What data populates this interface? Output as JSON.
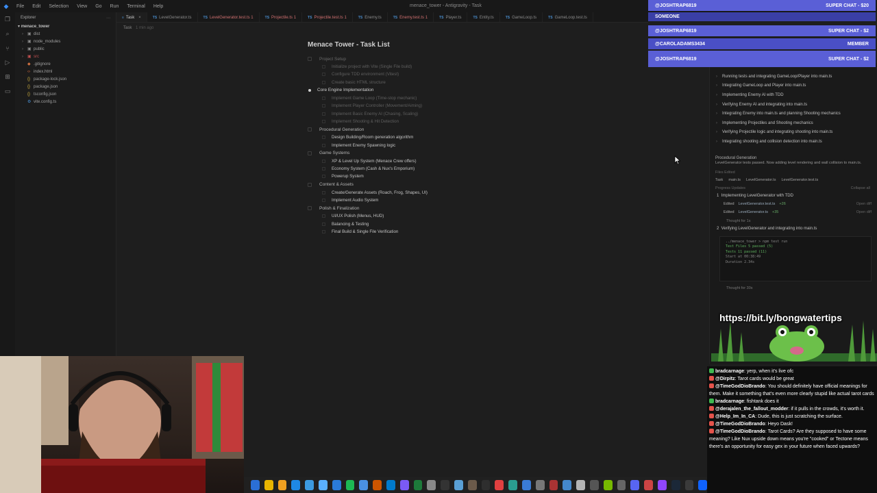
{
  "menubar": {
    "items": [
      "File",
      "Edit",
      "Selection",
      "View",
      "Go",
      "Run",
      "Terminal",
      "Help"
    ],
    "window_title": "menace_tower - Antigravity - Task"
  },
  "sidebar": {
    "title": "Explorer",
    "root": "menace_tower",
    "items": [
      {
        "label": "dist",
        "kind": "folder"
      },
      {
        "label": "node_modules",
        "kind": "folder"
      },
      {
        "label": "public",
        "kind": "folder"
      },
      {
        "label": "src",
        "kind": "folder-err"
      },
      {
        "label": ".gitignore",
        "kind": "git"
      },
      {
        "label": "index.html",
        "kind": "html"
      },
      {
        "label": "package-lock.json",
        "kind": "json"
      },
      {
        "label": "package.json",
        "kind": "json"
      },
      {
        "label": "tsconfig.json",
        "kind": "json"
      },
      {
        "label": "vite.config.ts",
        "kind": "ts"
      }
    ]
  },
  "tabs": [
    {
      "label": "Task",
      "active": true,
      "err": false
    },
    {
      "label": "LevelGenerator.ts",
      "active": false,
      "err": false
    },
    {
      "label": "LevelGenerator.test.ts 1",
      "active": false,
      "err": true
    },
    {
      "label": "Projectile.ts 1",
      "active": false,
      "err": true
    },
    {
      "label": "Projectile.test.ts 1",
      "active": false,
      "err": true
    },
    {
      "label": "Enemy.ts",
      "active": false,
      "err": false
    },
    {
      "label": "Enemy.test.ts 1",
      "active": false,
      "err": true
    },
    {
      "label": "Player.ts",
      "active": false,
      "err": false
    },
    {
      "label": "Entity.ts",
      "active": false,
      "err": false
    },
    {
      "label": "GameLoop.ts",
      "active": false,
      "err": false
    },
    {
      "label": "GameLoop.test.ts",
      "active": false,
      "err": false
    }
  ],
  "breadcrumb": {
    "label": "Task",
    "time": "1 min ago"
  },
  "doc": {
    "title": "Menace Tower - Task List",
    "sections": [
      {
        "label": "Project Setup",
        "state": "done",
        "items": [
          {
            "label": "Initialize project with Vite (Single File build)",
            "done": true
          },
          {
            "label": "Configure TDD environment (Vitest)",
            "done": true
          },
          {
            "label": "Create basic HTML structure",
            "done": true
          }
        ]
      },
      {
        "label": "Core Engine Implementation",
        "state": "current",
        "items": [
          {
            "label": "Implement Game Loop (Time-stop mechanic)",
            "done": true
          },
          {
            "label": "Implement Player Controller (Movement/Aiming)",
            "done": true
          },
          {
            "label": "Implement Basic Enemy AI (Chasing, Scaling)",
            "done": true
          },
          {
            "label": "Implement Shooting & Hit Detection",
            "done": true
          }
        ]
      },
      {
        "label": "Procedural Generation",
        "state": "todo",
        "items": [
          {
            "label": "Design Building/Room generation algorithm",
            "done": false
          },
          {
            "label": "Implement Enemy Spawning logic",
            "done": false
          }
        ]
      },
      {
        "label": "Game Systems",
        "state": "todo",
        "items": [
          {
            "label": "XP & Level Up System (Menace Crew offers)",
            "done": false
          },
          {
            "label": "Economy System (Cash & Nux's Emporium)",
            "done": false
          },
          {
            "label": "Powerup System",
            "done": false
          }
        ]
      },
      {
        "label": "Content & Assets",
        "state": "todo",
        "items": [
          {
            "label": "Create/Generate Assets (Roach, Frog, Shapes, UI)",
            "done": false
          },
          {
            "label": "Implement Audio System",
            "done": false
          }
        ]
      },
      {
        "label": "Polish & Finalization",
        "state": "todo",
        "items": [
          {
            "label": "UI/UX Polish (Menus, HUD)",
            "done": false
          },
          {
            "label": "Balancing & Testing",
            "done": false
          },
          {
            "label": "Final Build & Single File Verification",
            "done": false
          }
        ]
      }
    ]
  },
  "agent": {
    "steps": [
      "Running tests and integrating GameLoop/Player into main.ts",
      "Integrating GameLoop and Player into main.ts",
      "Implementing Enemy AI with TDD",
      "Verifying Enemy AI and integrating into main.ts",
      "Integrating Enemy into main.ts and planning Shooting mechanics",
      "Implementing Projectiles and Shooting mechanics",
      "Verifying Projectile logic and integrating shooting into main.ts",
      "Integrating shooting and collision detection into main.ts"
    ],
    "current_title": "Procedural Generation",
    "current_desc": "LevelGenerator tests passed. Now adding level rendering and wall collision to main.ts.",
    "files_edited_label": "Files Edited",
    "files_edited": [
      "Task",
      "main.ts",
      "LevelGenerator.ts",
      "LevelGenerator.test.ts"
    ],
    "progress_label": "Progress Updates",
    "collapse_label": "Collapse all",
    "progress": [
      {
        "title": "Implementing LevelGenerator with TDD",
        "edits": [
          {
            "action": "Edited",
            "file": "LevelGenerator.test.ts",
            "diff": "+26",
            "open": "Open diff"
          },
          {
            "action": "Edited",
            "file": "LevelGenerator.ts",
            "diff": "+35",
            "open": "Open diff"
          }
        ],
        "thought": "Thought for 1s"
      },
      {
        "title": "Verifying LevelGenerator and integrating into main.ts"
      }
    ],
    "terminal": {
      "cmd": "../menace_tower > npm test run",
      "lines": [
        "Test Files  5 passed (5)",
        "Tests  11 passed (11)",
        "Start at  00:38:49",
        "Duration  2.34s"
      ]
    },
    "thought2": "Thought for 30s"
  },
  "overlays": {
    "banners": [
      {
        "name": "@JOSHTRAP6819",
        "tag": "SUPER CHAT - $20",
        "color": "#5a5fd6"
      },
      {
        "name": "SOMEONE",
        "tag": "",
        "color": "#3a3fa6"
      },
      {
        "name": "@JOSHTRAP6819",
        "tag": "SUPER CHAT - $2",
        "color": "#5a5fd6"
      },
      {
        "name": "@CAROLADAMS3434",
        "tag": "MEMBER",
        "color": "#4a4fc6"
      },
      {
        "name": "@JOSHTRAP6819",
        "tag": "SUPER CHAT - $2",
        "color": "#5a5fd6"
      }
    ],
    "bong_url": "https://bit.ly/bongwatertips"
  },
  "chat": [
    {
      "badge": "#3fb950",
      "author": "bradcarnage",
      "text": "yerp, when it's live ofc"
    },
    {
      "badge": "#e5534b",
      "author": "@Dirpitz",
      "text": "Tarot cards would be great"
    },
    {
      "badge": "#e5534b",
      "author": "@TimeGodDioBrando",
      "text": "You should definitely have official meanings for them. Make it something that's even more clearly stupid like actual tarot cards"
    },
    {
      "badge": "#3fb950",
      "author": "bradcarnage",
      "text": "fishtank does it"
    },
    {
      "badge": "#e5534b",
      "author": "@derajalen_the_fallout_modder",
      "text": "if it pulls in the crowds, it's worth it."
    },
    {
      "badge": "#e5534b",
      "author": "@Help_Im_In_CA",
      "text": "Dude, this is just scratching the surface."
    },
    {
      "badge": "#e5534b",
      "author": "@TimeGodDioBrando",
      "text": "Heyo Dask!"
    },
    {
      "badge": "#e5534b",
      "author": "@TimeGodDioBrando",
      "text": "Tarot Cards? Are they supposed to have some meaning? Like Nux upside down means you're \"cooked\" or Tectone means there's an opportunity for easy gex in your future when faced upwards?"
    }
  ],
  "taskbar": {
    "icons": [
      "file-explorer-icon",
      "chrome-icon",
      "folder-icon",
      "edge-icon",
      "monitor-icon",
      "app-icon",
      "mail-icon",
      "spotify-icon",
      "store-icon",
      "browser-icon",
      "vscode-icon",
      "antigravity-icon",
      "excel-icon",
      "settings-icon",
      "terminal-icon",
      "notepad-icon",
      "gimp-icon",
      "obs-icon",
      "chrome2-icon",
      "vpn-icon",
      "photos-icon",
      "tools-icon",
      "record-icon",
      "paint-icon",
      "studio-icon",
      "media-icon",
      "nvidia-icon",
      "calc-icon",
      "discord-icon",
      "video-icon",
      "twitch-icon",
      "steam-icon",
      "monitor2-icon",
      "vscode2-icon"
    ]
  }
}
